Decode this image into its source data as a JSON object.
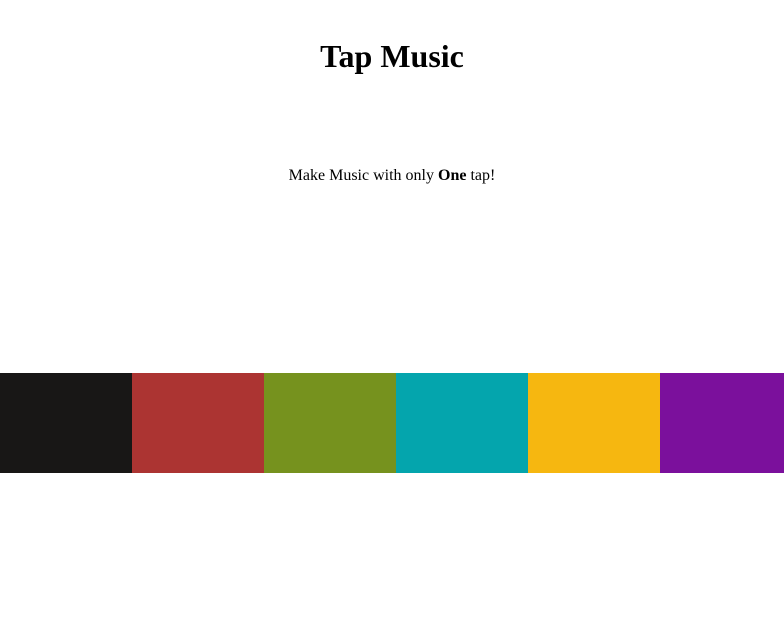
{
  "header": {
    "title": "Tap Music"
  },
  "intro": {
    "prefix": "Make Music with only ",
    "emphasis": "One",
    "suffix": " tap!"
  },
  "pads": [
    {
      "name": "pad-black",
      "color": "#181716"
    },
    {
      "name": "pad-red",
      "color": "#AC3432"
    },
    {
      "name": "pad-green",
      "color": "#76921E"
    },
    {
      "name": "pad-teal",
      "color": "#04A5AD"
    },
    {
      "name": "pad-yellow",
      "color": "#F6B710"
    },
    {
      "name": "pad-purple",
      "color": "#7B109C"
    }
  ]
}
